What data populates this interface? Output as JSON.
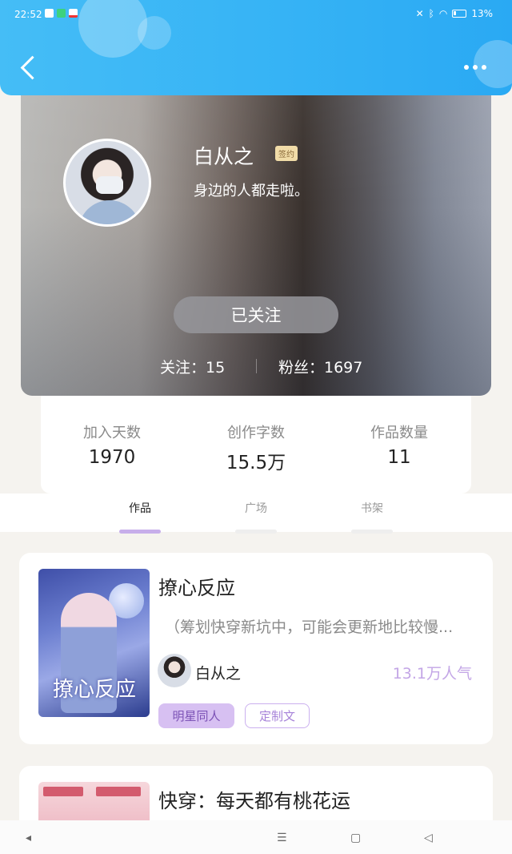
{
  "status_bar": {
    "time": "22:52",
    "battery": "13%"
  },
  "profile": {
    "name": "白从之",
    "badge": "签约",
    "bio": "身边的人都走啦。",
    "follow_button": "已关注",
    "following_label": "关注：15",
    "fans_label": "粉丝：1697"
  },
  "stats": [
    {
      "label": "加入天数",
      "value": "1970"
    },
    {
      "label": "创作字数",
      "value": "15.5万"
    },
    {
      "label": "作品数量",
      "value": "11"
    }
  ],
  "tabs": [
    {
      "label": "作品",
      "active": true
    },
    {
      "label": "广场",
      "active": false
    },
    {
      "label": "书架",
      "active": false
    }
  ],
  "books": [
    {
      "title": "撩心反应",
      "cover_text": "撩心反应",
      "description": "（筹划快穿新坑中，可能会更新地比较慢...",
      "author": "白从之",
      "popularity": "13.1万人气",
      "tags": [
        "明星同人",
        "定制文"
      ]
    },
    {
      "title": "快穿：每天都有桃花运"
    }
  ],
  "colors": {
    "header": "#36b3f5",
    "accent_purple": "#c3a6e6",
    "tag_fill": "#d7c0f2",
    "badge_gold": "#f1dca8"
  },
  "nav": {
    "back": "◂",
    "menu": "☰",
    "home": "▢",
    "recent": "◁"
  }
}
